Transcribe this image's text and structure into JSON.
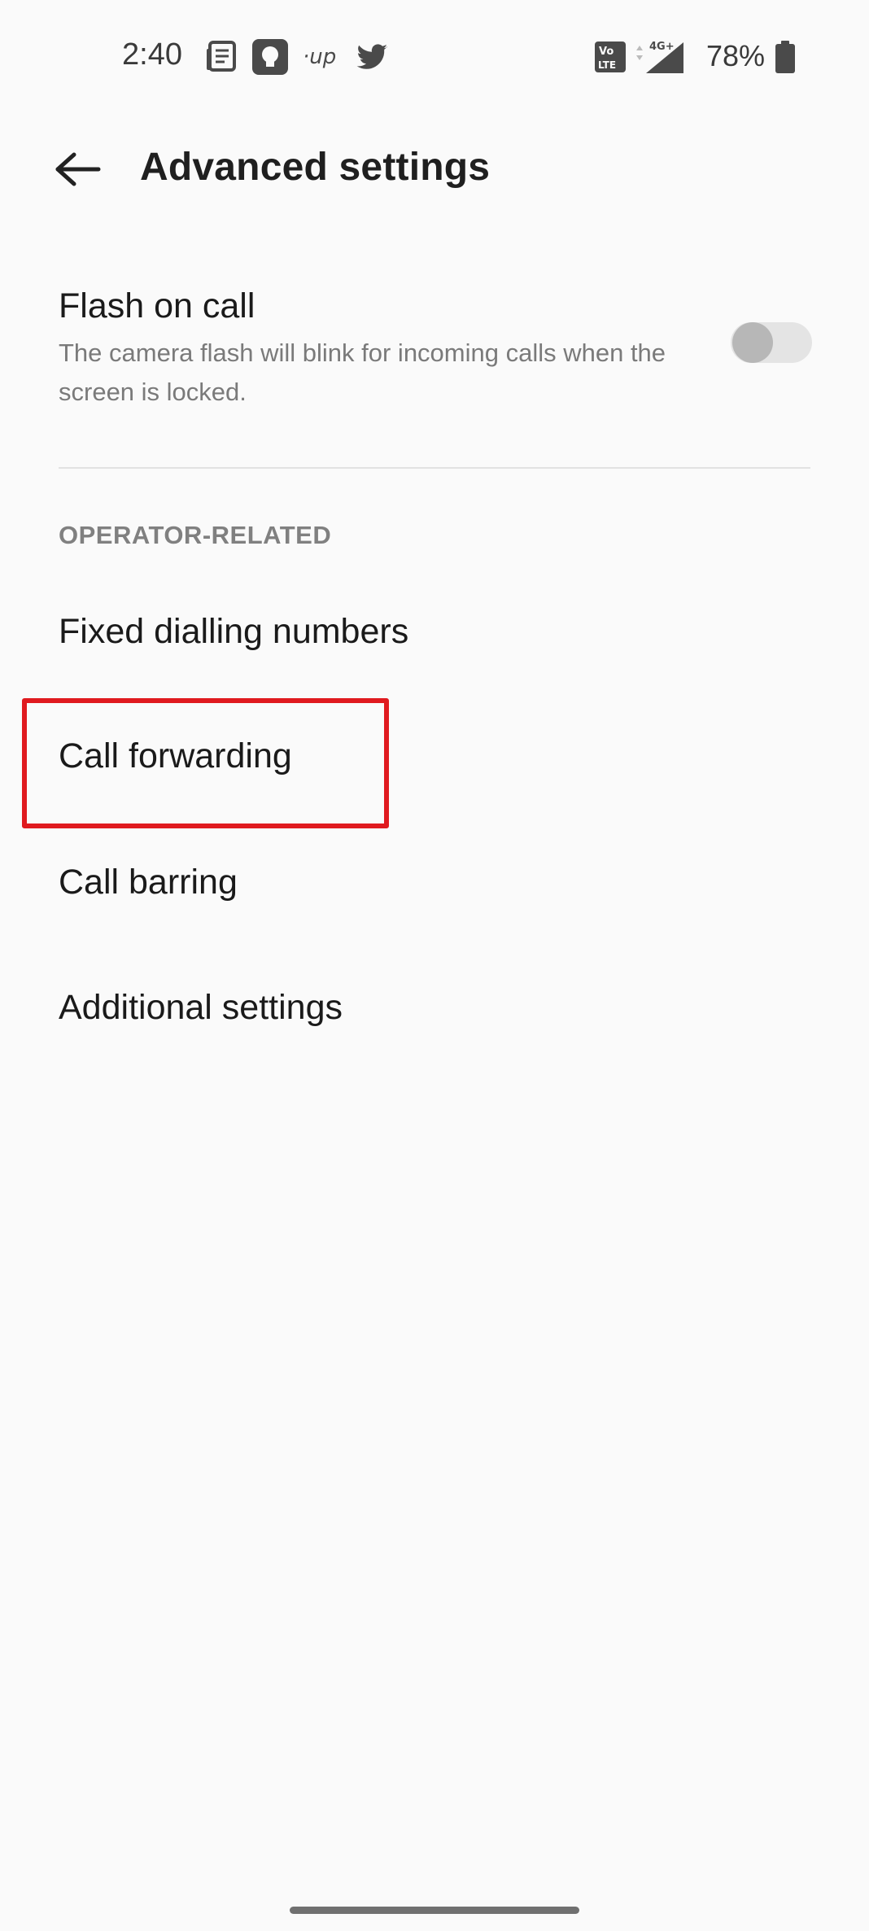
{
  "status_bar": {
    "time": "2:40",
    "battery": "78%",
    "icons": [
      "news-icon",
      "bulb-icon",
      "up-icon",
      "twitter-icon",
      "volte-icon",
      "4g-signal-icon",
      "battery-icon"
    ],
    "volte_top": "Vo",
    "volte_bottom": "LTE",
    "network_type": "4G+",
    "up_logo": "·up"
  },
  "app_bar": {
    "title": "Advanced settings"
  },
  "flash_on_call": {
    "title": "Flash on call",
    "description": "The camera flash will blink for incoming calls when the screen is locked.",
    "enabled": false
  },
  "operator_section": {
    "header": "OPERATOR-RELATED",
    "items": [
      {
        "label": "Fixed dialling numbers"
      },
      {
        "label": "Call forwarding"
      },
      {
        "label": "Call barring"
      },
      {
        "label": "Additional settings"
      }
    ]
  },
  "colors": {
    "background": "#fafafa",
    "highlight": "#e01a1f",
    "secondary_text": "#7a7a7a"
  }
}
